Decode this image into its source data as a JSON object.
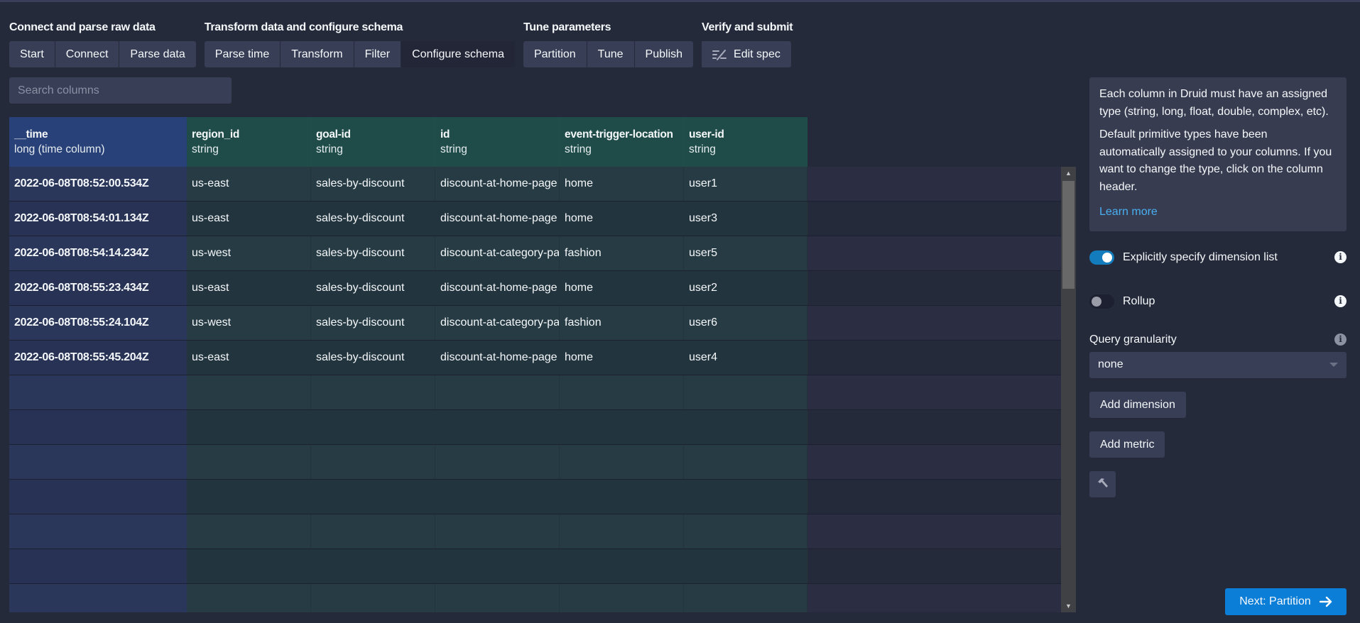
{
  "steps": {
    "groups": [
      {
        "title": "Connect and parse raw data",
        "buttons": [
          {
            "label": "Start"
          },
          {
            "label": "Connect"
          },
          {
            "label": "Parse data"
          }
        ]
      },
      {
        "title": "Transform data and configure schema",
        "buttons": [
          {
            "label": "Parse time"
          },
          {
            "label": "Transform"
          },
          {
            "label": "Filter"
          },
          {
            "label": "Configure schema",
            "active": true
          }
        ]
      },
      {
        "title": "Tune parameters",
        "buttons": [
          {
            "label": "Partition"
          },
          {
            "label": "Tune"
          },
          {
            "label": "Publish"
          }
        ]
      },
      {
        "title": "Verify and submit",
        "buttons": [
          {
            "label": "Edit spec",
            "icon": "edit-spec-icon"
          }
        ]
      }
    ]
  },
  "search": {
    "placeholder": "Search columns",
    "value": ""
  },
  "table": {
    "columns": [
      {
        "name": "__time",
        "type": "long (time column)",
        "kind": "time"
      },
      {
        "name": "region_id",
        "type": "string",
        "kind": "dimension"
      },
      {
        "name": "goal-id",
        "type": "string",
        "kind": "dimension"
      },
      {
        "name": "id",
        "type": "string",
        "kind": "dimension"
      },
      {
        "name": "event-trigger-location",
        "type": "string",
        "kind": "dimension"
      },
      {
        "name": "user-id",
        "type": "string",
        "kind": "dimension"
      }
    ],
    "rows": [
      [
        "2022-06-08T08:52:00.534Z",
        "us-east",
        "sales-by-discount",
        "discount-at-home-page",
        "home",
        "user1"
      ],
      [
        "2022-06-08T08:54:01.134Z",
        "us-east",
        "sales-by-discount",
        "discount-at-home-page",
        "home",
        "user3"
      ],
      [
        "2022-06-08T08:54:14.234Z",
        "us-west",
        "sales-by-discount",
        "discount-at-category-page",
        "fashion",
        "user5"
      ],
      [
        "2022-06-08T08:55:23.434Z",
        "us-east",
        "sales-by-discount",
        "discount-at-home-page",
        "home",
        "user2"
      ],
      [
        "2022-06-08T08:55:24.104Z",
        "us-west",
        "sales-by-discount",
        "discount-at-category-page",
        "fashion",
        "user6"
      ],
      [
        "2022-06-08T08:55:45.204Z",
        "us-east",
        "sales-by-discount",
        "discount-at-home-page",
        "home",
        "user4"
      ]
    ],
    "empty_rows": 7
  },
  "panel": {
    "info": {
      "paragraph1": "Each column in Druid must have an assigned type (string, long, float, double, complex, etc).",
      "paragraph2": "Default primitive types have been automatically assigned to your columns. If you want to change the type, click on the column header.",
      "link": "Learn more"
    },
    "explicit_dimensions": {
      "label": "Explicitly specify dimension list",
      "checked": true
    },
    "rollup": {
      "label": "Rollup",
      "checked": false
    },
    "query_granularity": {
      "label": "Query granularity",
      "value": "none"
    },
    "add_dimension": "Add dimension",
    "add_metric": "Add metric"
  },
  "next_button": {
    "label": "Next: Partition"
  },
  "colors": {
    "accent": "#0b7ed8",
    "time_column": "#284178",
    "dimension_column": "#1f4c48",
    "link": "#48aff0"
  }
}
